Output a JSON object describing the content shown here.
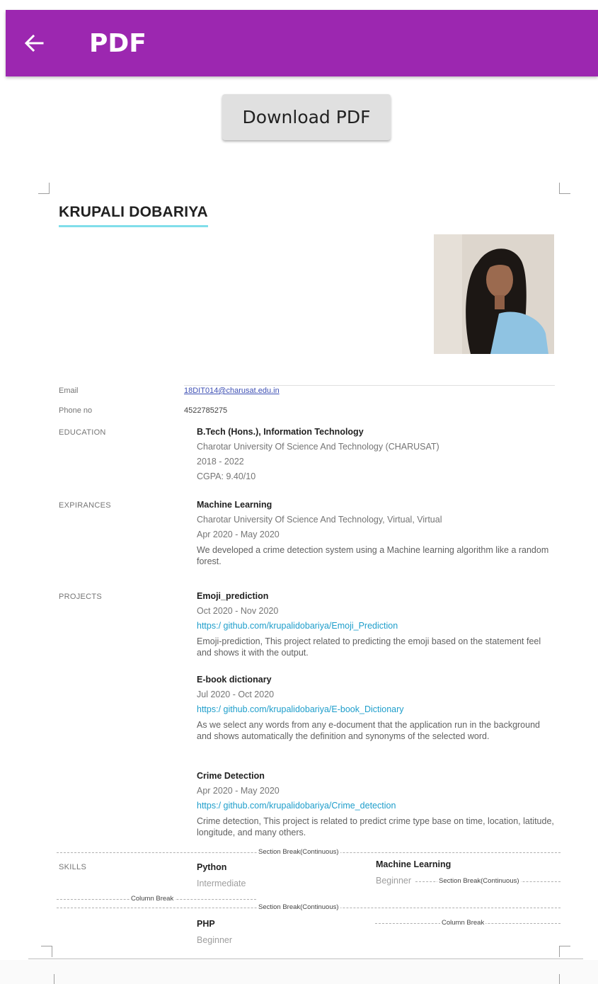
{
  "appbar": {
    "title": "PDF",
    "back_icon": "arrow-left-icon",
    "color": "#9c27b0"
  },
  "download_button": {
    "label": "Download PDF"
  },
  "resume": {
    "name": "KRUPALI DOBARIYA",
    "email_label": "Email",
    "email": "18DIT014@charusat.edu.in",
    "phone_label": "Phone no",
    "phone": "4522785275",
    "education": {
      "label": "EDUCATION",
      "degree": "B.Tech (Hons.), Information Technology",
      "school": "Charotar University Of Science And Technology (CHARUSAT)",
      "years": "2018 - 2022",
      "cgpa": "CGPA: 9.40/10"
    },
    "experience": {
      "label": "EXPIRANCES",
      "title": "Machine Learning",
      "org": "Charotar University Of Science And Technology, Virtual, Virtual",
      "dates": "Apr 2020 - May 2020",
      "desc": "We developed a crime detection system using a Machine learning algorithm like a random forest."
    },
    "projects_label": "PROJECTS",
    "projects": [
      {
        "title": "Emoji_prediction",
        "dates": "Oct 2020 - Nov 2020",
        "url": "https:/ github.com/krupalidobariya/Emoji_Prediction",
        "desc": "Emoji-prediction, This project related to predicting the emoji based on the statement feel and shows it with the output."
      },
      {
        "title": "E-book dictionary",
        "dates": "Jul 2020 - Oct 2020",
        "url": "https:/ github.com/krupalidobariya/E-book_Dictionary",
        "desc": "As we select any words from any e-document that the application run in the background and shows automatically the definition and synonyms of the selected word."
      },
      {
        "title": "Crime Detection",
        "dates": "Apr 2020 - May 2020",
        "url": "https:/ github.com/krupalidobariya/Crime_detection",
        "desc": "Crime detection, This project is related to predict crime type base on time, location, latitude, longitude, and many others."
      }
    ],
    "skills_label": "SKILLS",
    "skills": [
      {
        "name": "Python",
        "level": "Intermediate"
      },
      {
        "name": "Machine Learning",
        "level": "Beginner"
      },
      {
        "name": "PHP",
        "level": "Beginner"
      }
    ],
    "markers": {
      "section_break": "Section Break(Continuous)",
      "column_break": "Column Break"
    }
  }
}
